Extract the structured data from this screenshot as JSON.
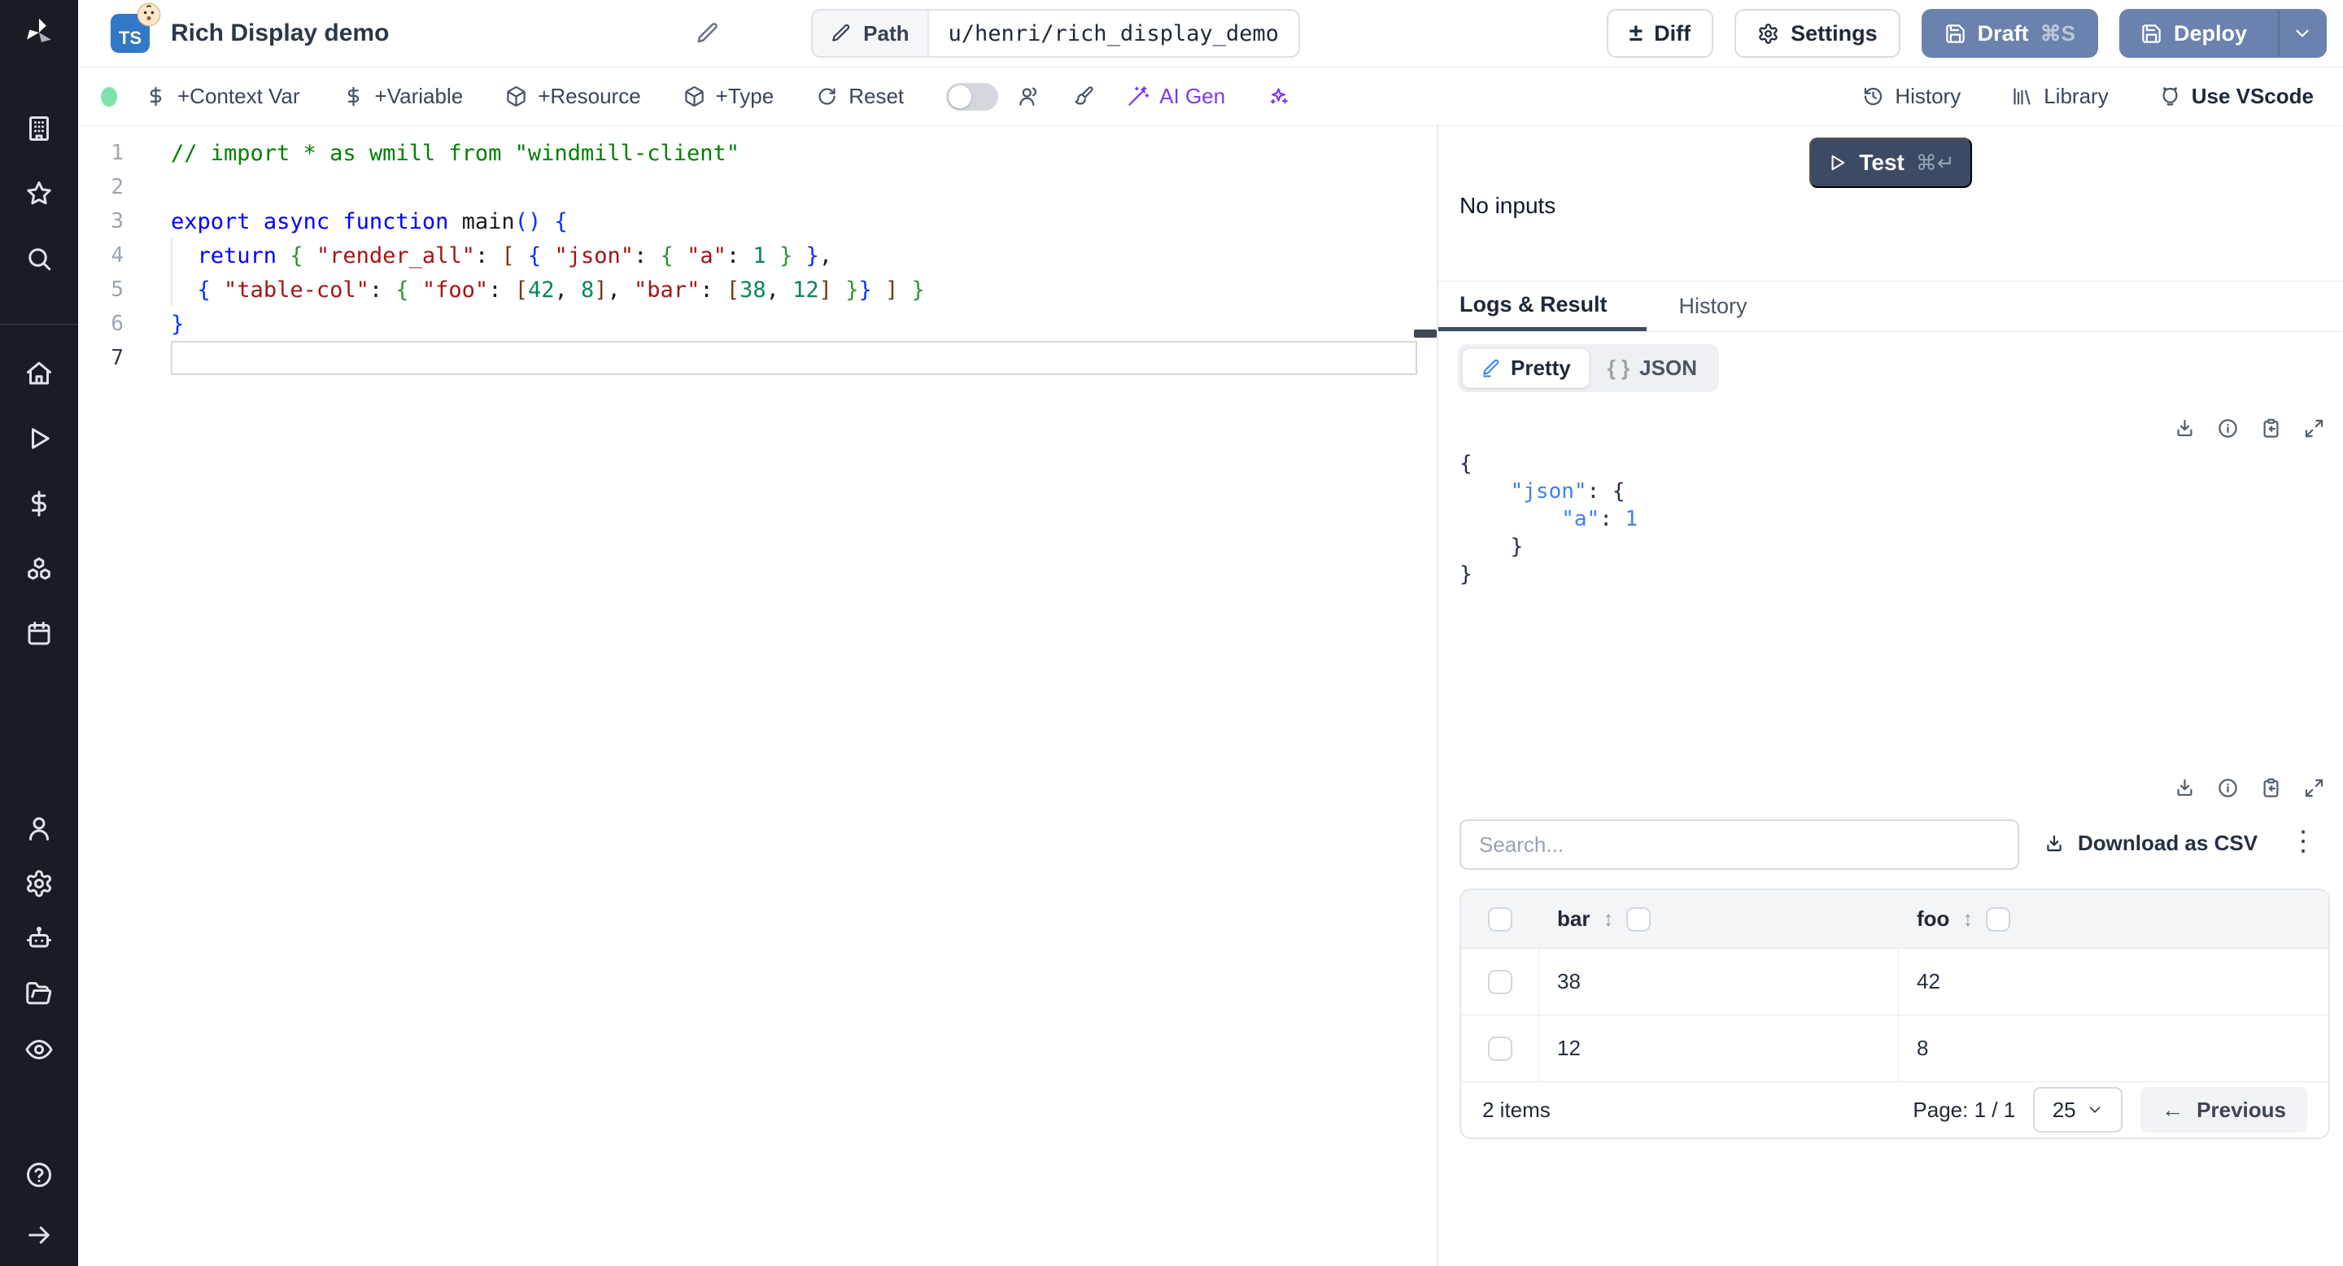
{
  "header": {
    "title": "Rich Display demo",
    "file_badge": "TS",
    "path_label": "Path",
    "path_value": "u/henri/rich_display_demo",
    "diff": "Diff",
    "diff_glyph": "±",
    "settings": "Settings",
    "draft": "Draft",
    "draft_shortcut": "⌘S",
    "deploy": "Deploy"
  },
  "toolbar": {
    "context_var": "+Context Var",
    "variable": "+Variable",
    "resource": "+Resource",
    "type": "+Type",
    "reset": "Reset",
    "ai_gen": "AI Gen",
    "history": "History",
    "library": "Library",
    "vscode": "Use VScode"
  },
  "editor": {
    "lines": [
      {
        "n": "1",
        "guide": false,
        "active": false,
        "segments": [
          {
            "c": "comment",
            "t": "// import * as wmill from \"windmill-client\""
          }
        ]
      },
      {
        "n": "2",
        "guide": false,
        "active": false,
        "segments": []
      },
      {
        "n": "3",
        "guide": false,
        "active": false,
        "segments": [
          {
            "c": "kw",
            "t": "export"
          },
          {
            "c": "plain",
            "t": " "
          },
          {
            "c": "kw",
            "t": "async"
          },
          {
            "c": "plain",
            "t": " "
          },
          {
            "c": "kw",
            "t": "function"
          },
          {
            "c": "plain",
            "t": " main"
          },
          {
            "c": "b1",
            "t": "()"
          },
          {
            "c": "plain",
            "t": " "
          },
          {
            "c": "b1",
            "t": "{"
          }
        ]
      },
      {
        "n": "4",
        "guide": true,
        "active": false,
        "segments": [
          {
            "c": "plain",
            "t": "  "
          },
          {
            "c": "kw",
            "t": "return"
          },
          {
            "c": "plain",
            "t": " "
          },
          {
            "c": "b2",
            "t": "{"
          },
          {
            "c": "plain",
            "t": " "
          },
          {
            "c": "str",
            "t": "\"render_all\""
          },
          {
            "c": "plain",
            "t": ": "
          },
          {
            "c": "b3",
            "t": "["
          },
          {
            "c": "plain",
            "t": " "
          },
          {
            "c": "b1",
            "t": "{"
          },
          {
            "c": "plain",
            "t": " "
          },
          {
            "c": "str",
            "t": "\"json\""
          },
          {
            "c": "plain",
            "t": ": "
          },
          {
            "c": "b2",
            "t": "{"
          },
          {
            "c": "plain",
            "t": " "
          },
          {
            "c": "str",
            "t": "\"a\""
          },
          {
            "c": "plain",
            "t": ": "
          },
          {
            "c": "num",
            "t": "1"
          },
          {
            "c": "plain",
            "t": " "
          },
          {
            "c": "b2",
            "t": "}"
          },
          {
            "c": "plain",
            "t": " "
          },
          {
            "c": "b1",
            "t": "}"
          },
          {
            "c": "plain",
            "t": ","
          }
        ]
      },
      {
        "n": "5",
        "guide": true,
        "active": false,
        "segments": [
          {
            "c": "plain",
            "t": "  "
          },
          {
            "c": "b1",
            "t": "{"
          },
          {
            "c": "plain",
            "t": " "
          },
          {
            "c": "str",
            "t": "\"table-col\""
          },
          {
            "c": "plain",
            "t": ": "
          },
          {
            "c": "b2",
            "t": "{"
          },
          {
            "c": "plain",
            "t": " "
          },
          {
            "c": "str",
            "t": "\"foo\""
          },
          {
            "c": "plain",
            "t": ": "
          },
          {
            "c": "b3",
            "t": "["
          },
          {
            "c": "num",
            "t": "42"
          },
          {
            "c": "plain",
            "t": ", "
          },
          {
            "c": "num",
            "t": "8"
          },
          {
            "c": "b3",
            "t": "]"
          },
          {
            "c": "plain",
            "t": ", "
          },
          {
            "c": "str",
            "t": "\"bar\""
          },
          {
            "c": "plain",
            "t": ": "
          },
          {
            "c": "b3",
            "t": "["
          },
          {
            "c": "num",
            "t": "38"
          },
          {
            "c": "plain",
            "t": ", "
          },
          {
            "c": "num",
            "t": "12"
          },
          {
            "c": "b3",
            "t": "]"
          },
          {
            "c": "plain",
            "t": " "
          },
          {
            "c": "b2",
            "t": "}"
          },
          {
            "c": "b1",
            "t": "}"
          },
          {
            "c": "plain",
            "t": " "
          },
          {
            "c": "b3",
            "t": "]"
          },
          {
            "c": "plain",
            "t": " "
          },
          {
            "c": "b2",
            "t": "}"
          }
        ]
      },
      {
        "n": "6",
        "guide": false,
        "active": false,
        "segments": [
          {
            "c": "b1",
            "t": "}"
          }
        ]
      },
      {
        "n": "7",
        "guide": false,
        "active": true,
        "segments": []
      }
    ]
  },
  "run": {
    "test": "Test",
    "shortcut": "⌘↵",
    "no_inputs": "No inputs"
  },
  "tabs": {
    "logs": "Logs & Result",
    "history": "History"
  },
  "result": {
    "pretty": "Pretty",
    "json": "JSON",
    "brace_glyph": "{ }",
    "json_lines": [
      [
        {
          "c": "d",
          "t": "{"
        }
      ],
      [
        {
          "c": "d",
          "t": "    "
        },
        {
          "c": "b",
          "t": "\"json\""
        },
        {
          "c": "d",
          "t": ": {"
        }
      ],
      [
        {
          "c": "d",
          "t": "        "
        },
        {
          "c": "b",
          "t": "\"a\""
        },
        {
          "c": "d",
          "t": ": "
        },
        {
          "c": "b",
          "t": "1"
        }
      ],
      [
        {
          "c": "d",
          "t": "    }"
        }
      ],
      [
        {
          "c": "d",
          "t": "}"
        }
      ]
    ],
    "search_placeholder": "Search...",
    "download_csv": "Download as CSV",
    "kebab_glyph": "⋮",
    "table": {
      "columns": [
        "bar",
        "foo"
      ],
      "rows": [
        [
          "38",
          "42"
        ],
        [
          "12",
          "8"
        ]
      ],
      "sort_glyph": "↕"
    },
    "footer": {
      "items": "2 items",
      "page": "Page: 1 / 1",
      "page_size": "25",
      "prev_arrow": "←",
      "previous": "Previous"
    }
  },
  "colors": {
    "accent_blue": "#3b82f6",
    "button_slate": "#6a82ad",
    "button_dark": "#3d4a63",
    "ai_purple": "#7c3aed",
    "green_dot": "#7ee2a8",
    "sidebar_bg": "#181c23"
  }
}
